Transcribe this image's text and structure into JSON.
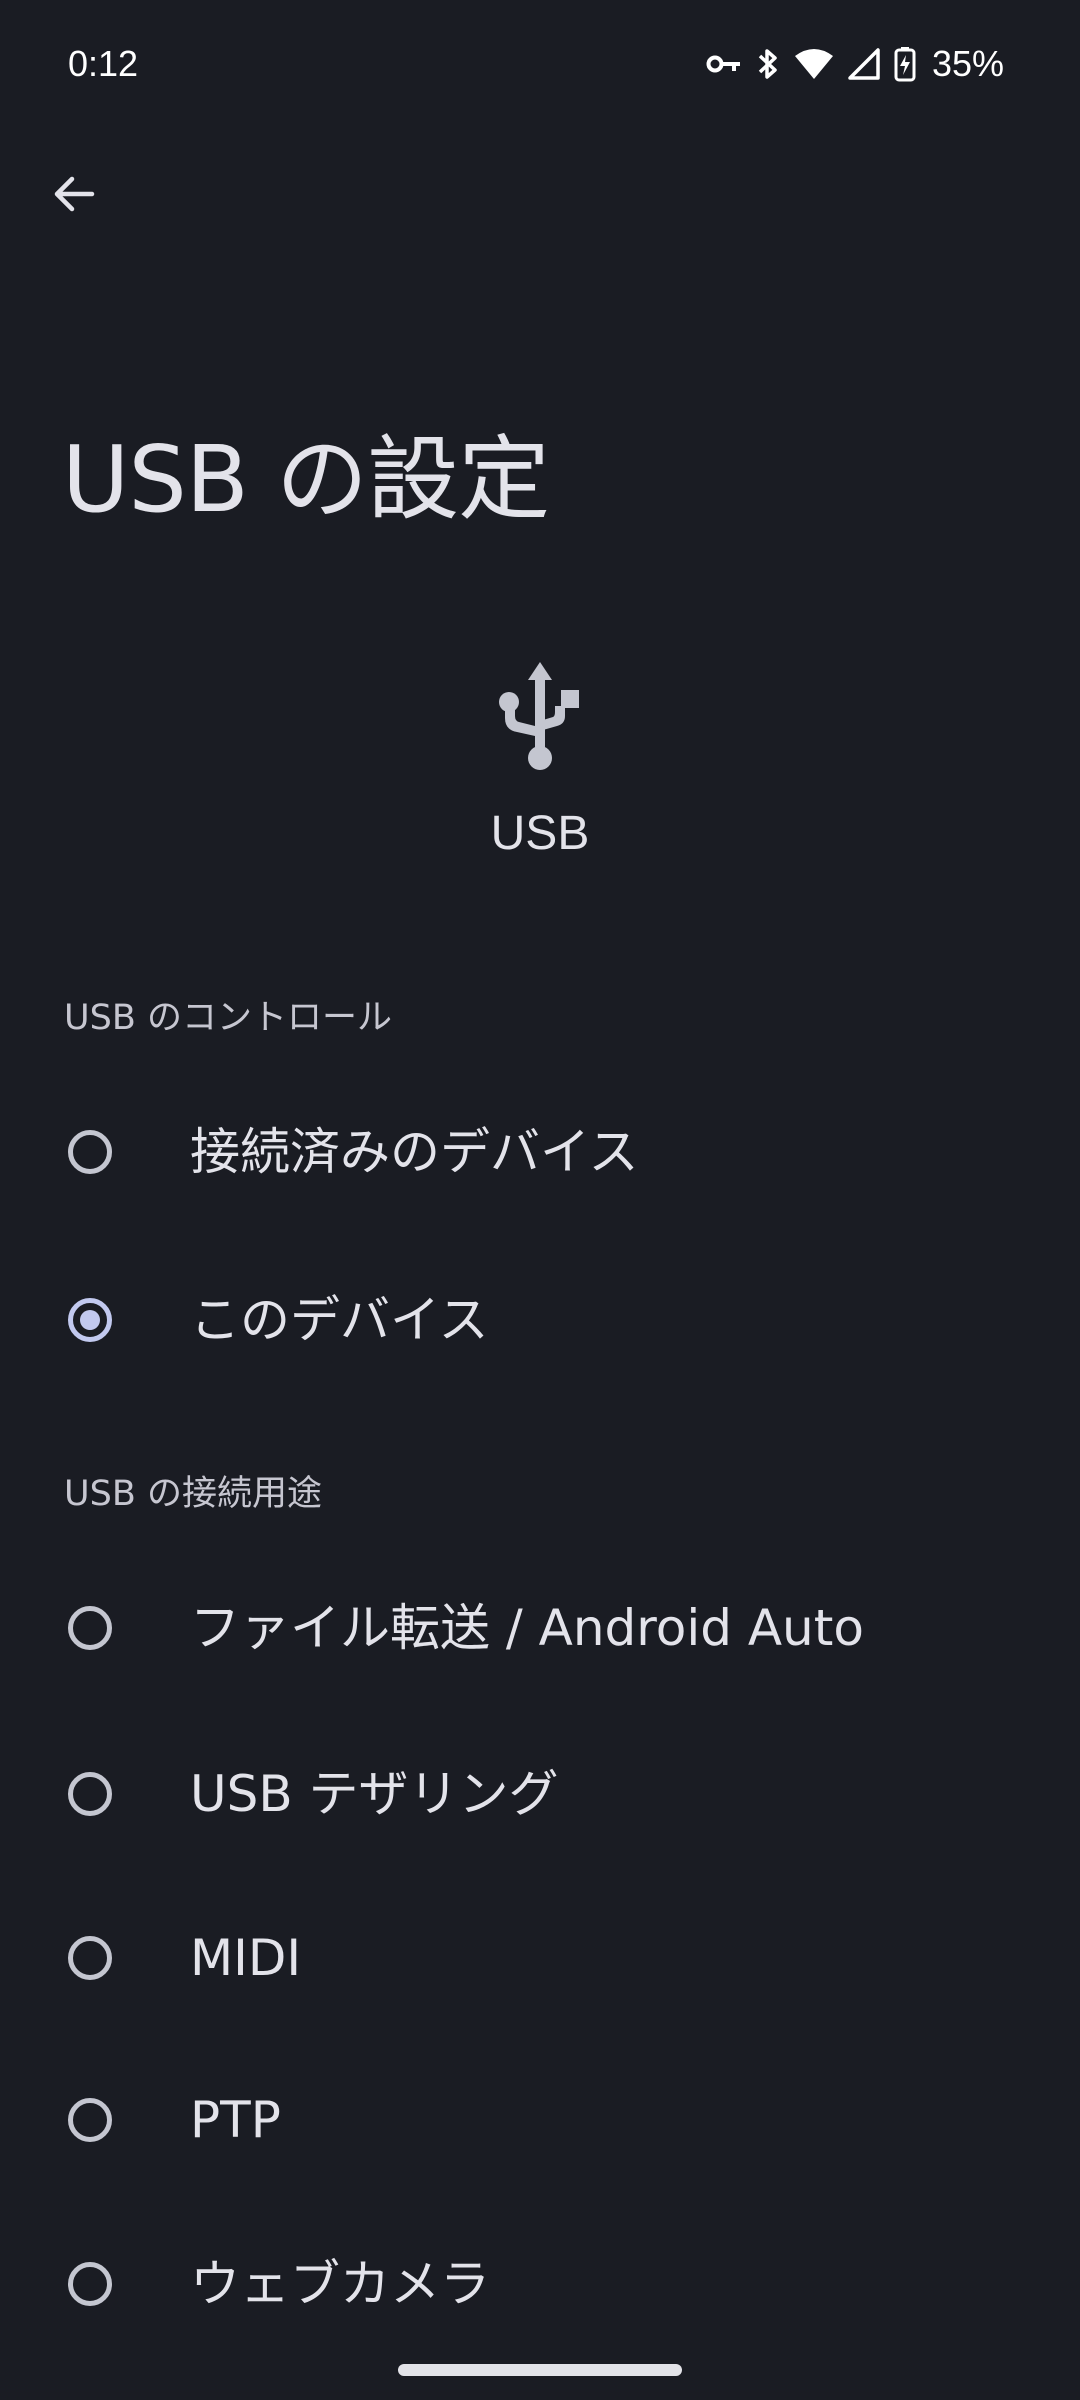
{
  "status_bar": {
    "time": "0:12",
    "battery_percent": "35%",
    "icons": [
      "vpn-key-icon",
      "bluetooth-icon",
      "wifi-icon",
      "cell-signal-icon",
      "battery-charging-icon"
    ]
  },
  "header": {
    "back_icon": "arrow-back-icon",
    "title": "USB の設定"
  },
  "hero": {
    "icon": "usb-icon",
    "label": "USB"
  },
  "usb_control": {
    "header": "USB のコントロール",
    "options": [
      {
        "label": "接続済みのデバイス",
        "selected": false
      },
      {
        "label": "このデバイス",
        "selected": true
      }
    ]
  },
  "usb_purpose": {
    "header": "USB の接続用途",
    "options": [
      {
        "label": "ファイル転送 / Android Auto",
        "selected": false
      },
      {
        "label": "USB テザリング",
        "selected": false
      },
      {
        "label": "MIDI",
        "selected": false
      },
      {
        "label": "PTP",
        "selected": false
      },
      {
        "label": "ウェブカメラ",
        "selected": false
      }
    ]
  },
  "colors": {
    "background": "#1a1c23",
    "text_primary": "#e3e3ea",
    "text_secondary": "#c6c6d0",
    "radio_accent": "#c2c9ef"
  }
}
